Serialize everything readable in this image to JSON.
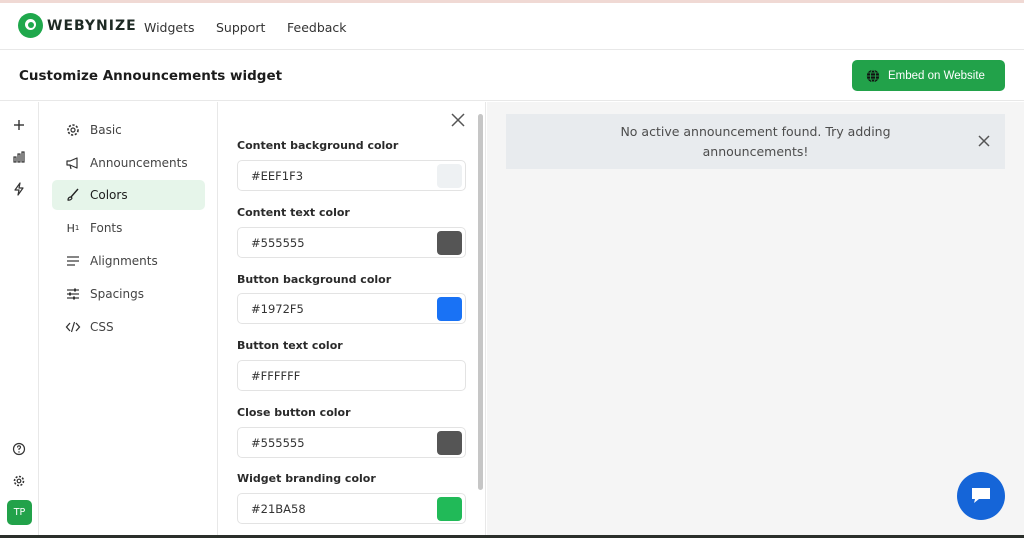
{
  "nav": {
    "logo_text": "WEBYNIZE",
    "links": [
      "Widgets",
      "Support",
      "Feedback"
    ]
  },
  "header": {
    "title": "Customize Announcements widget",
    "embed_label": "Embed on Website"
  },
  "rail": {
    "icons": [
      "plus-icon",
      "bar-chart-icon",
      "lightning-icon",
      "help-icon",
      "settings-icon"
    ],
    "avatar_initials": "TP"
  },
  "menu": {
    "items": [
      {
        "label": "Basic",
        "icon": "gear-icon"
      },
      {
        "label": "Announcements",
        "icon": "megaphone-icon"
      },
      {
        "label": "Colors",
        "icon": "brush-icon",
        "active": true
      },
      {
        "label": "Fonts",
        "icon": "heading-icon"
      },
      {
        "label": "Alignments",
        "icon": "align-icon"
      },
      {
        "label": "Spacings",
        "icon": "sliders-icon"
      },
      {
        "label": "CSS",
        "icon": "code-icon"
      }
    ]
  },
  "colors": {
    "fields": [
      {
        "label": "Content background color",
        "value": "#EEF1F3",
        "swatch": "#EEF1F3"
      },
      {
        "label": "Content text color",
        "value": "#555555",
        "swatch": "#555555"
      },
      {
        "label": "Button background color",
        "value": "#1972F5",
        "swatch": "#1972F5"
      },
      {
        "label": "Button text color",
        "value": "#FFFFFF",
        "swatch": "#FFFFFF"
      },
      {
        "label": "Close button color",
        "value": "#555555",
        "swatch": "#555555"
      },
      {
        "label": "Widget branding color",
        "value": "#21BA58",
        "swatch": "#21BA58"
      }
    ]
  },
  "preview": {
    "notice": "No active announcement found. Try adding announcements!"
  },
  "theme": {
    "accent": "#22A24A",
    "chat_button": "#1565D8"
  }
}
